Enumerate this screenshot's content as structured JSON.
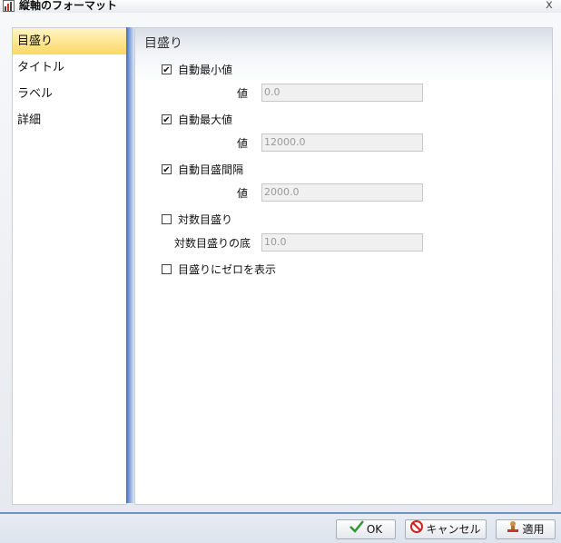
{
  "window": {
    "title": "縦軸のフォーマット",
    "close_glyph": "x"
  },
  "nav": {
    "items": [
      "目盛り",
      "タイトル",
      "ラベル",
      "詳細"
    ],
    "active_index": 0
  },
  "panel": {
    "title": "目盛り",
    "auto_min": {
      "label": "自動最小値",
      "checked": true,
      "value_label": "値",
      "value": "0.0"
    },
    "auto_max": {
      "label": "自動最大値",
      "checked": true,
      "value_label": "値",
      "value": "12000.0"
    },
    "auto_interval": {
      "label": "自動目盛間隔",
      "checked": true,
      "value_label": "値",
      "value": "2000.0"
    },
    "log_scale": {
      "label": "対数目盛り",
      "checked": false,
      "base_label": "対数目盛りの底",
      "base_value": "10.0"
    },
    "show_zero": {
      "label": "目盛りにゼロを表示",
      "checked": false
    }
  },
  "footer": {
    "ok_label": "OK",
    "cancel_label": "キャンセル",
    "apply_label": "適用"
  },
  "colors": {
    "accent": "#3b6fc6",
    "active_nav": "#fbd763",
    "ok_check": "#2e9a2e",
    "cancel_icon": "#d02020"
  }
}
